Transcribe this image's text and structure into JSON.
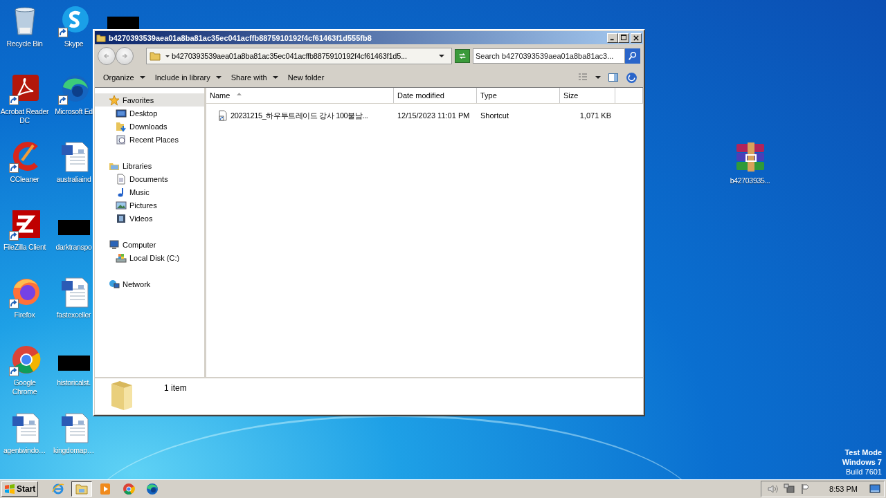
{
  "desktop": {
    "icons": [
      {
        "label": "Recycle Bin",
        "kind": "recycle",
        "shortcut": false
      },
      {
        "label": "Acrobat Reader DC",
        "kind": "acrobat",
        "shortcut": true
      },
      {
        "label": "CCleaner",
        "kind": "ccleaner",
        "shortcut": true
      },
      {
        "label": "FileZilla Client",
        "kind": "filezilla",
        "shortcut": true
      },
      {
        "label": "Firefox",
        "kind": "firefox",
        "shortcut": true
      },
      {
        "label": "Google Chrome",
        "kind": "chrome",
        "shortcut": true
      },
      {
        "label": "agentwindo…",
        "kind": "word",
        "shortcut": false
      },
      {
        "label": "Skype",
        "kind": "skype",
        "shortcut": true
      },
      {
        "label": "Microsoft Ed",
        "kind": "edge",
        "shortcut": true
      },
      {
        "label": "australiaind",
        "kind": "word",
        "shortcut": false
      },
      {
        "label": "darktranspo",
        "kind": "redacted"
      },
      {
        "label": "fastexceller",
        "kind": "word",
        "shortcut": false
      },
      {
        "label": "historicalst.",
        "kind": "redacted"
      },
      {
        "label": "kingdomap…",
        "kind": "word",
        "shortcut": false
      },
      {
        "kind": "redacted"
      }
    ],
    "archive": {
      "label": "b42703935..."
    },
    "test_mode": [
      "Test Mode",
      "Windows 7",
      "Build 7601"
    ]
  },
  "window": {
    "title": "b4270393539aea01a8ba81ac35ec041acffb8875910192f4cf61463f1d555fb8",
    "address": "b4270393539aea01a8ba81ac35ec041acffb8875910192f4cf61463f1d5...",
    "search": {
      "placeholder": "Search b4270393539aea01a8ba81ac3..."
    },
    "toolbar": [
      {
        "label": "Organize",
        "dropdown": true
      },
      {
        "label": "Include in library",
        "dropdown": true
      },
      {
        "label": "Share with",
        "dropdown": true
      },
      {
        "label": "New folder",
        "dropdown": false
      }
    ],
    "nav": [
      {
        "label": "Favorites",
        "kind": "star",
        "selected": true,
        "children": [
          {
            "label": "Desktop",
            "kind": "desktop",
            "selected": false
          },
          {
            "label": "Downloads",
            "kind": "downloads",
            "selected": false
          },
          {
            "label": "Recent Places",
            "kind": "recent",
            "selected": false
          }
        ]
      },
      {
        "label": "Libraries",
        "kind": "libraries",
        "selected": false,
        "children": [
          {
            "label": "Documents",
            "kind": "documents",
            "selected": false
          },
          {
            "label": "Music",
            "kind": "music",
            "selected": false
          },
          {
            "label": "Pictures",
            "kind": "pictures",
            "selected": false
          },
          {
            "label": "Videos",
            "kind": "videos",
            "selected": false
          }
        ]
      },
      {
        "label": "Computer",
        "kind": "computer",
        "selected": false,
        "children": [
          {
            "label": "Local Disk (C:)",
            "kind": "disk",
            "selected": false
          }
        ]
      },
      {
        "label": "Network",
        "kind": "network",
        "selected": false
      }
    ],
    "columns": [
      {
        "label": "Name",
        "sorted": true
      },
      {
        "label": "Date modified",
        "sorted": false
      },
      {
        "label": "Type",
        "sorted": false
      },
      {
        "label": "Size",
        "sorted": false
      }
    ],
    "rows": [
      {
        "name": "20231215_하우투트레이드 강사 100불남...",
        "date": "12/15/2023 11:01 PM",
        "type": "Shortcut",
        "size": "1,071 KB",
        "selected": false
      }
    ],
    "status": "1 item"
  },
  "taskbar": {
    "start": "Start",
    "apps": [
      {
        "kind": "ie",
        "active": false
      },
      {
        "kind": "explorer",
        "active": true
      },
      {
        "kind": "media",
        "active": false
      },
      {
        "kind": "chrome",
        "active": false
      },
      {
        "kind": "edge",
        "active": false
      }
    ],
    "clock": "8:53 PM"
  }
}
